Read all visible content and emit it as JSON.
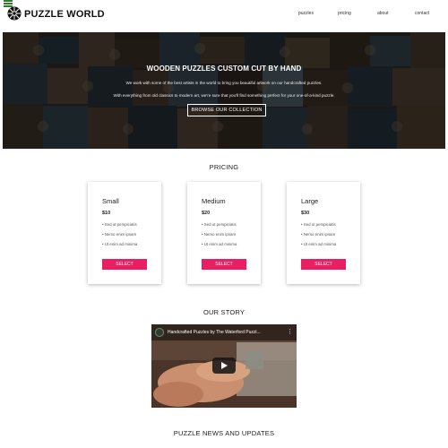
{
  "header": {
    "brand": "PUZZLE WORLD",
    "nav": [
      "puzzles",
      "pricing",
      "about",
      "contact"
    ]
  },
  "hero": {
    "title": "WOODEN PUZZLES CUSTOM CUT BY HAND",
    "line1": "We work with some of the best artists in the world to bring you beautiful artwork on our handcrafted puzzles.",
    "line2": "With everything from old classics to modern art, we're sure that you'll find something perfect for your one-of-a-kind puzzle.",
    "button": "BROWSE OUR COLLECTION"
  },
  "pricing": {
    "title": "PRICING",
    "cards": [
      {
        "name": "Small",
        "price": "$10",
        "features": [
          "Sed ut perspiciatis",
          "Nemo enim ipsam",
          "Ut enim ad minima"
        ],
        "button": "SELECT"
      },
      {
        "name": "Medium",
        "price": "$20",
        "features": [
          "Sed ut perspiciatis",
          "Nemo enim ipsam",
          "Ut enim ad minima"
        ],
        "button": "SELECT"
      },
      {
        "name": "Large",
        "price": "$30",
        "features": [
          "Sed ut perspiciatis",
          "Nemo enim ipsam",
          "Ut enim ad minima"
        ],
        "button": "SELECT"
      }
    ]
  },
  "story": {
    "title": "OUR STORY",
    "video_title": "Handcrafted Puzzles by The Waterford Puzzl..."
  },
  "news": {
    "title": "PUZZLE NEWS AND UPDATES"
  },
  "colors": {
    "accent": "#e91e63",
    "menu": "#2e7d32"
  }
}
